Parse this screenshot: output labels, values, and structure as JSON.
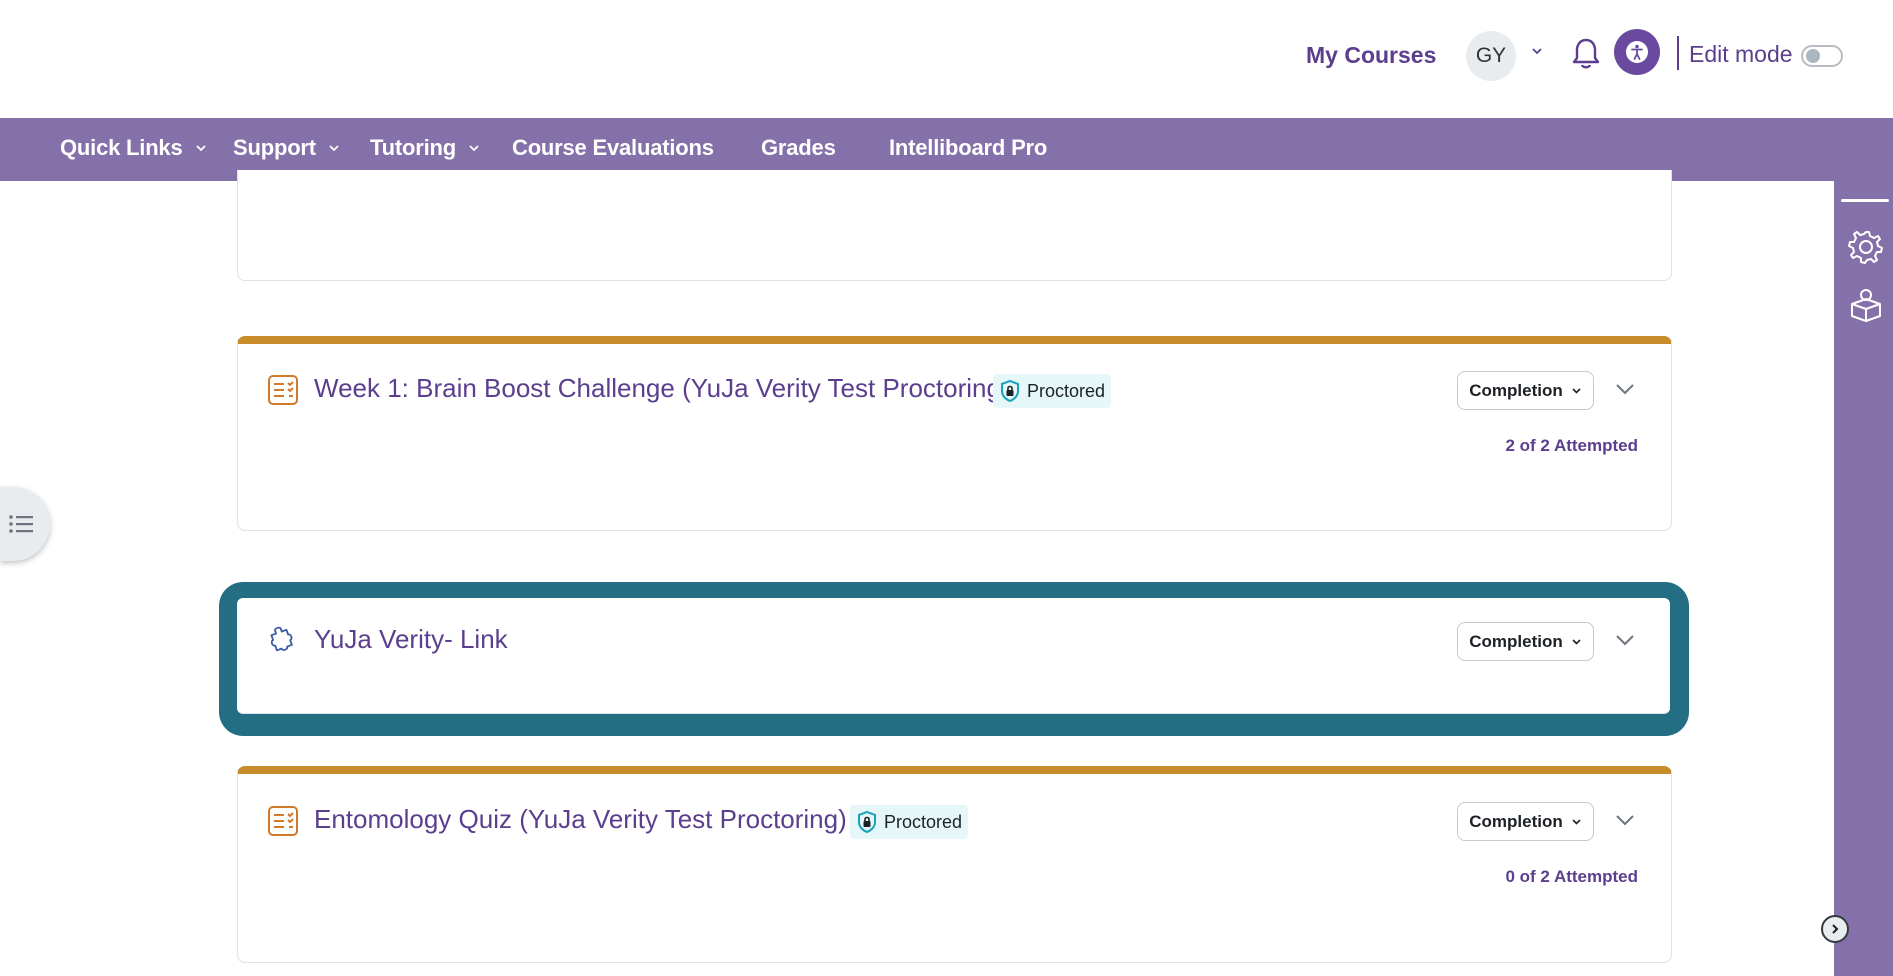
{
  "header": {
    "my_courses": "My Courses",
    "avatar_initials": "GY",
    "edit_mode_label": "Edit mode"
  },
  "nav": {
    "items": [
      {
        "label": "Quick Links",
        "has_dropdown": true
      },
      {
        "label": "Support",
        "has_dropdown": true
      },
      {
        "label": "Tutoring",
        "has_dropdown": true
      },
      {
        "label": "Course Evaluations",
        "has_dropdown": false
      },
      {
        "label": "Grades",
        "has_dropdown": false
      },
      {
        "label": "Intelliboard Pro",
        "has_dropdown": false
      }
    ]
  },
  "activities": [
    {
      "title": "Week 1: Brain Boost Challenge (YuJa Verity Test Proctoring)",
      "icon": "quiz-icon",
      "badge": "Proctored",
      "completion_label": "Completion",
      "attempts": "2 of 2 Attempted"
    },
    {
      "title": "YuJa Verity- Link",
      "icon": "puzzle-icon",
      "completion_label": "Completion",
      "highlighted": true
    },
    {
      "title": "Entomology Quiz (YuJa Verity Test Proctoring)",
      "icon": "quiz-icon",
      "badge": "Proctored",
      "completion_label": "Completion",
      "attempts": "0 of 2 Attempted"
    }
  ],
  "colors": {
    "brand_purple": "#8571a9",
    "link_purple": "#5b3f8e",
    "quiz_accent": "#c88c2a",
    "highlight_teal": "#236e82",
    "proctored_bg": "#e5f7f8"
  }
}
